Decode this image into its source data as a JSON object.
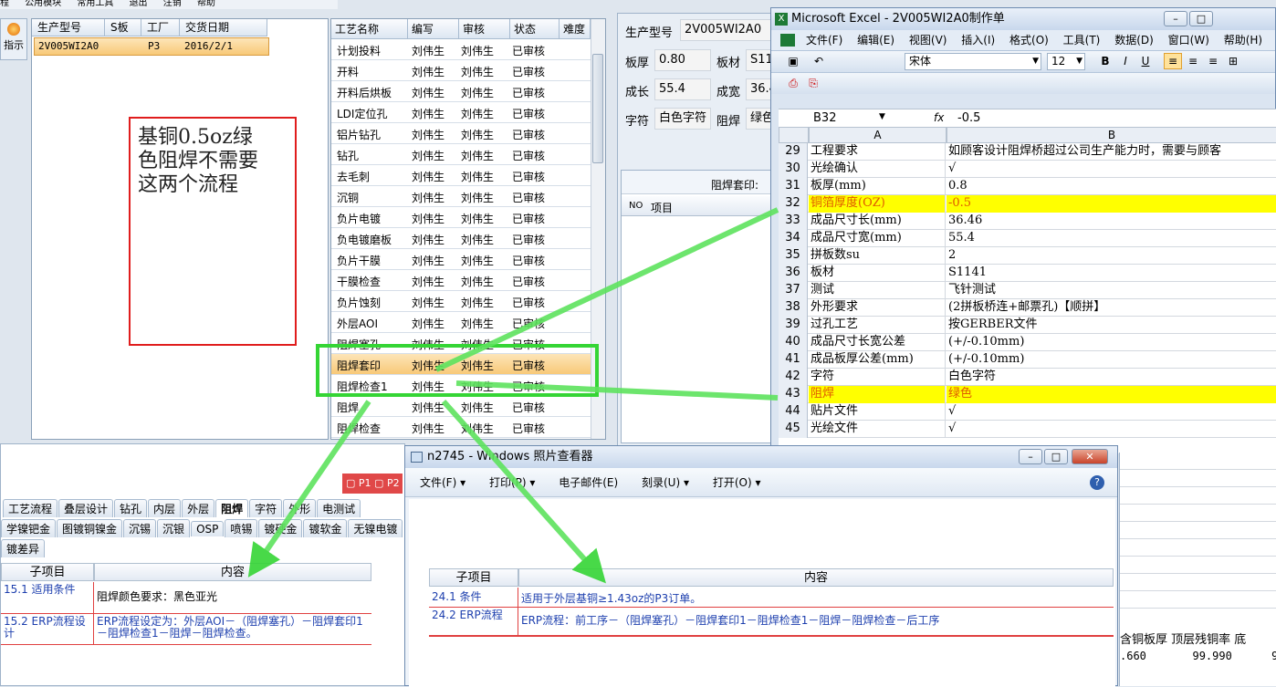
{
  "topmenu": [
    "程",
    "公用模块",
    "常用工具",
    "退出",
    "注销",
    "帮助"
  ],
  "left_button": "指示",
  "orders": {
    "headers": [
      "生产型号",
      "S板",
      "工厂",
      "交货日期"
    ],
    "row": {
      "model": "2V005WI2A0",
      "factory": "P3",
      "date": "2016/2/1"
    }
  },
  "note": "基铜0.5oz绿\n色阻焊不需要\n这两个流程",
  "process": {
    "headers": [
      "工艺名称",
      "编写",
      "审核",
      "状态",
      "难度"
    ],
    "rows": [
      [
        "计划投料",
        "刘伟生",
        "刘伟生",
        "已审核"
      ],
      [
        "开料",
        "刘伟生",
        "刘伟生",
        "已审核"
      ],
      [
        "开料后烘板",
        "刘伟生",
        "刘伟生",
        "已审核"
      ],
      [
        "LDI定位孔",
        "刘伟生",
        "刘伟生",
        "已审核"
      ],
      [
        "铝片钻孔",
        "刘伟生",
        "刘伟生",
        "已审核"
      ],
      [
        "钻孔",
        "刘伟生",
        "刘伟生",
        "已审核"
      ],
      [
        "去毛刺",
        "刘伟生",
        "刘伟生",
        "已审核"
      ],
      [
        "沉铜",
        "刘伟生",
        "刘伟生",
        "已审核"
      ],
      [
        "负片电镀",
        "刘伟生",
        "刘伟生",
        "已审核"
      ],
      [
        "负电镀磨板",
        "刘伟生",
        "刘伟生",
        "已审核"
      ],
      [
        "负片干膜",
        "刘伟生",
        "刘伟生",
        "已审核"
      ],
      [
        "干膜检查",
        "刘伟生",
        "刘伟生",
        "已审核"
      ],
      [
        "负片蚀刻",
        "刘伟生",
        "刘伟生",
        "已审核"
      ],
      [
        "外层AOI",
        "刘伟生",
        "刘伟生",
        "已审核"
      ],
      [
        "阻焊塞孔",
        "刘伟生",
        "刘伟生",
        "已审核"
      ],
      [
        "阻焊套印",
        "刘伟生",
        "刘伟生",
        "已审核"
      ],
      [
        "阻焊检查1",
        "刘伟生",
        "刘伟生",
        "已审核"
      ],
      [
        "阻焊",
        "刘伟生",
        "刘伟生",
        "已审核"
      ],
      [
        "阻焊检查",
        "刘伟生",
        "刘伟生",
        "已审核"
      ]
    ]
  },
  "form": {
    "model_label": "生产型号",
    "model": "2V005WI2A0",
    "thick_label": "板厚",
    "thick": "0.80",
    "mat_label": "板材",
    "mat": "S11",
    "len_label": "成长",
    "len": "55.4",
    "wid_label": "成宽",
    "wid": "36.4",
    "char_label": "字符",
    "char": "白色字符",
    "mask_label": "阻焊",
    "mask": "绿色",
    "sub_title": "阻焊套印:",
    "sub_no": "NO",
    "sub_item": "项目"
  },
  "excel": {
    "title": "Microsoft Excel - 2V005WI2A0制作单",
    "menus": [
      "文件(F)",
      "编辑(E)",
      "视图(V)",
      "插入(I)",
      "格式(O)",
      "工具(T)",
      "数据(D)",
      "窗口(W)",
      "帮助(H)",
      "A"
    ],
    "font": "宋体",
    "size": "12",
    "cellref": "B32",
    "fx": "fx",
    "formula": "-0.5",
    "col_a": "A",
    "col_b": "B",
    "rows": [
      [
        "29",
        "工程要求",
        "如顾客设计阻焊桥超过公司生产能力时，需要与顾客"
      ],
      [
        "30",
        "光绘确认",
        "√"
      ],
      [
        "31",
        "板厚(mm)",
        "0.8"
      ],
      [
        "32",
        "铜箔厚度(OZ)",
        "-0.5"
      ],
      [
        "33",
        "成品尺寸长(mm)",
        "36.46"
      ],
      [
        "34",
        "成品尺寸宽(mm)",
        "55.4"
      ],
      [
        "35",
        "拼板数su",
        "2"
      ],
      [
        "36",
        "板材",
        "S1141"
      ],
      [
        "37",
        "测试",
        "飞针测试"
      ],
      [
        "38",
        "外形要求",
        "(2拼板桥连+邮票孔)【顺拼】"
      ],
      [
        "39",
        "过孔工艺",
        "按GERBER文件"
      ],
      [
        "40",
        "成品尺寸长宽公差",
        "(+/-0.10mm)"
      ],
      [
        "41",
        "成品板厚公差(mm)",
        "(+/-0.10mm)"
      ],
      [
        "42",
        "字符",
        "白色字符"
      ],
      [
        "43",
        "阻焊",
        "绿色"
      ],
      [
        "44",
        "贴片文件",
        "√"
      ],
      [
        "45",
        "光绘文件",
        "√"
      ]
    ],
    "bottom_headers": "含铜板厚 顶层残铜率 底",
    "bottom_values": ".660       99.990      9"
  },
  "bottom_left": {
    "mini": [
      "P1",
      "P2"
    ],
    "tabs1": [
      "工艺流程",
      "叠层设计",
      "钻孔",
      "内层",
      "外层",
      "阻焊",
      "字符",
      "外形",
      "电测试"
    ],
    "tabs2": [
      "学镍钯金",
      "图镀铜镍金",
      "沉锡",
      "沉银",
      "OSP",
      "喷锡",
      "镀硬金",
      "镀软金",
      "无镍电镀"
    ],
    "tab3": "镀差异",
    "h1": "子项目",
    "h2": "内容",
    "rows": [
      {
        "a": "15.1 适用条件",
        "b": "阻焊颜色要求：黑色亚光"
      },
      {
        "a": "15.2 ERP流程设计",
        "b": "ERP流程设定为：外层AOI－（阻焊塞孔）－阻焊套印1－阻焊检查1－阻焊－阻焊检查。"
      }
    ]
  },
  "viewer": {
    "title": "n2745 - Windows 照片查看器",
    "menus": [
      "文件(F) ▾",
      "打印(P) ▾",
      "电子邮件(E)",
      "刻录(U) ▾",
      "打开(O) ▾"
    ],
    "h1": "子项目",
    "h2": "内容",
    "rows": [
      {
        "a": "24.1 条件",
        "b": "适用于外层基铜≥1.43oz的P3订单。"
      },
      {
        "a": "24.2 ERP流程",
        "b": "ERP流程：前工序－（阻焊塞孔）－阻焊套印1－阻焊检查1－阻焊－阻焊检查－后工序"
      }
    ]
  },
  "colors": {
    "green": "#35d535",
    "red": "#e01d1d",
    "highlight": "#ffff00"
  }
}
